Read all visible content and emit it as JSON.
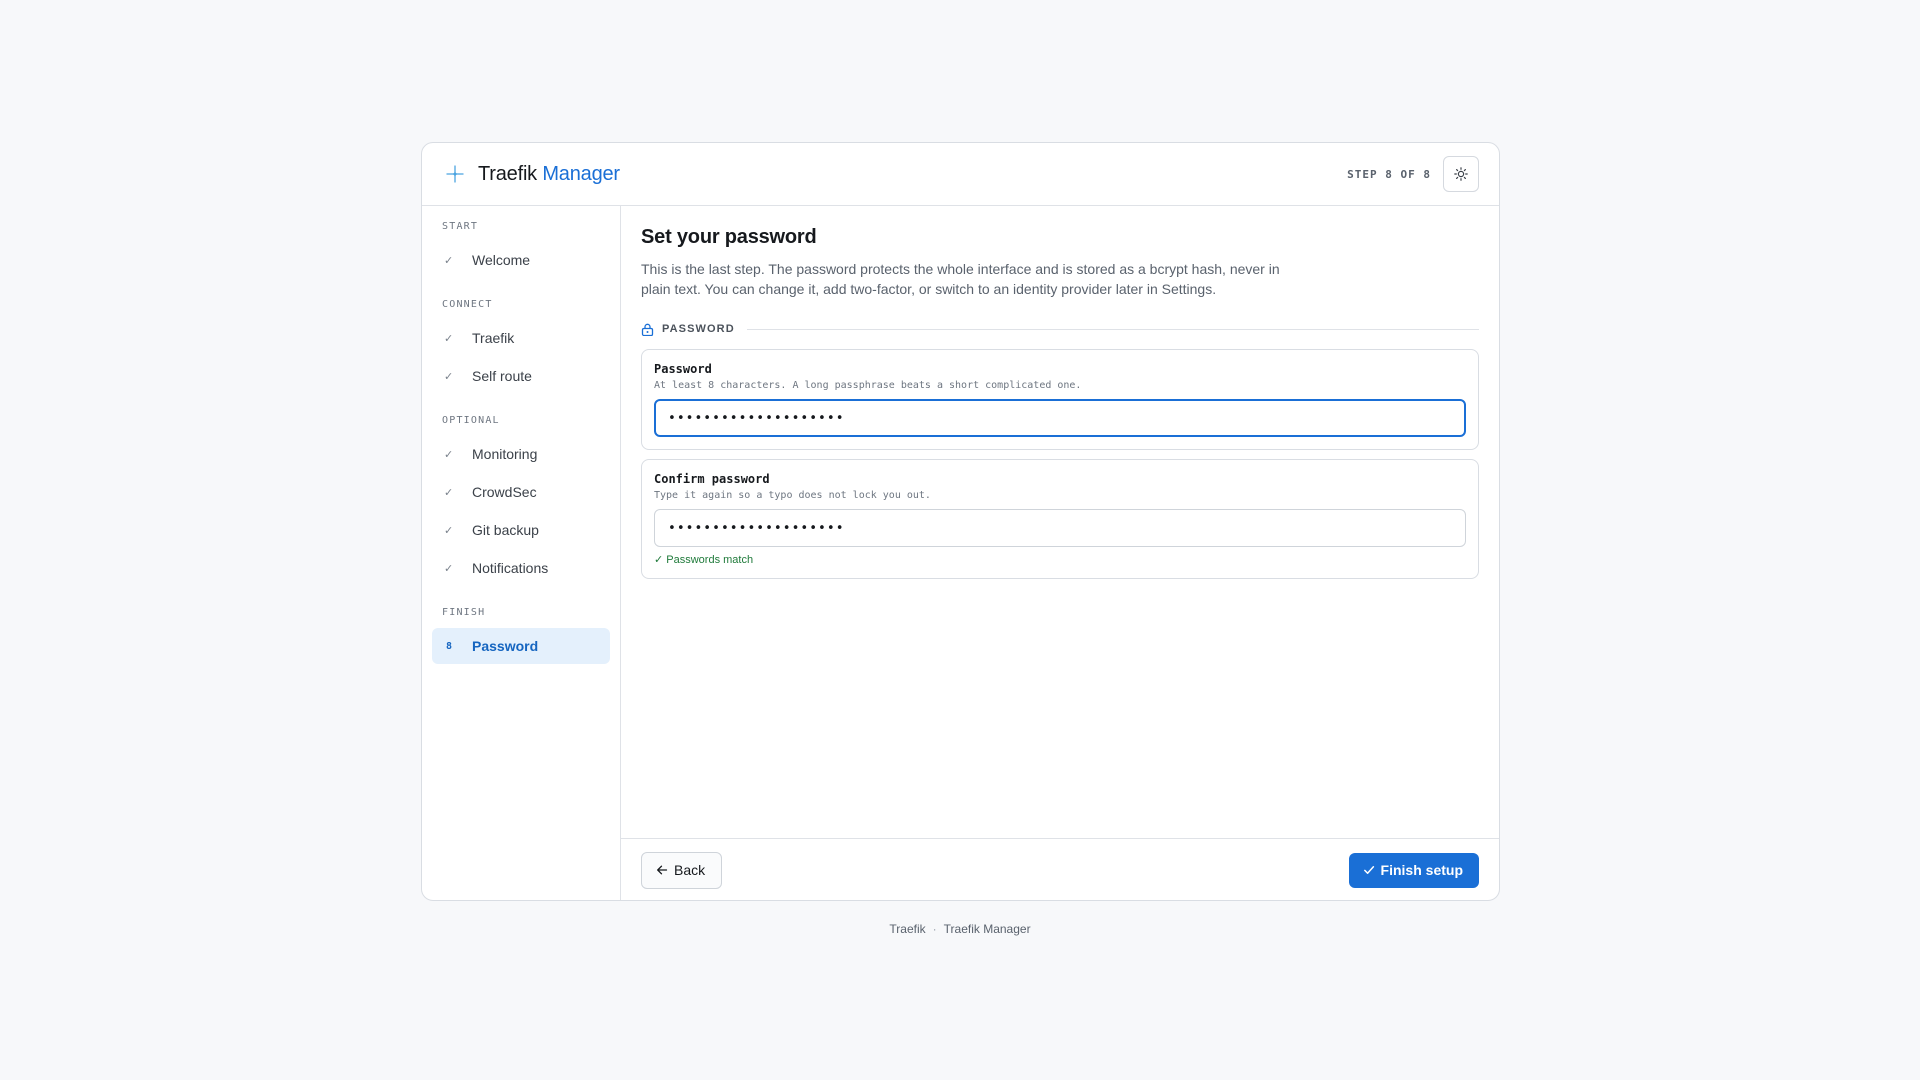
{
  "header": {
    "brand_first": "Traefik",
    "brand_accent": "Manager",
    "step_indicator": "STEP 8 OF 8",
    "theme_toggle_icon": "sun-icon"
  },
  "sidebar": {
    "groups": [
      {
        "label": "START",
        "items": [
          {
            "label": "Welcome",
            "marker": "✓"
          }
        ]
      },
      {
        "label": "CONNECT",
        "items": [
          {
            "label": "Traefik",
            "marker": "✓"
          },
          {
            "label": "Self route",
            "marker": "✓"
          }
        ]
      },
      {
        "label": "OPTIONAL",
        "items": [
          {
            "label": "Monitoring",
            "marker": "✓"
          },
          {
            "label": "CrowdSec",
            "marker": "✓"
          },
          {
            "label": "Git backup",
            "marker": "✓"
          },
          {
            "label": "Notifications",
            "marker": "✓"
          }
        ]
      },
      {
        "label": "FINISH",
        "items": [
          {
            "label": "Password",
            "marker": "8",
            "active": true
          }
        ]
      }
    ]
  },
  "main": {
    "title": "Set your password",
    "description": "This is the last step. The password protects the whole interface and is stored as a bcrypt hash, never in plain text. You can change it, add two-factor, or switch to an identity provider later in Settings.",
    "section_title": "PASSWORD",
    "password": {
      "label": "Password",
      "hint": "At least 8 characters. A long passphrase beats a short complicated one.",
      "value": "••••••••••••••••••••"
    },
    "confirm": {
      "label": "Confirm password",
      "hint": "Type it again so a typo does not lock you out.",
      "value": "••••••••••••••••••••",
      "match_message": "✓ Passwords match"
    }
  },
  "actions": {
    "back_label": "Back",
    "finish_label": "Finish setup"
  },
  "footer": {
    "left": "Traefik",
    "separator": "·",
    "right": "Traefik Manager"
  },
  "colors": {
    "accent": "#1a6fd6",
    "success": "#1f7a3a",
    "active_bg": "#e4f0fc"
  }
}
